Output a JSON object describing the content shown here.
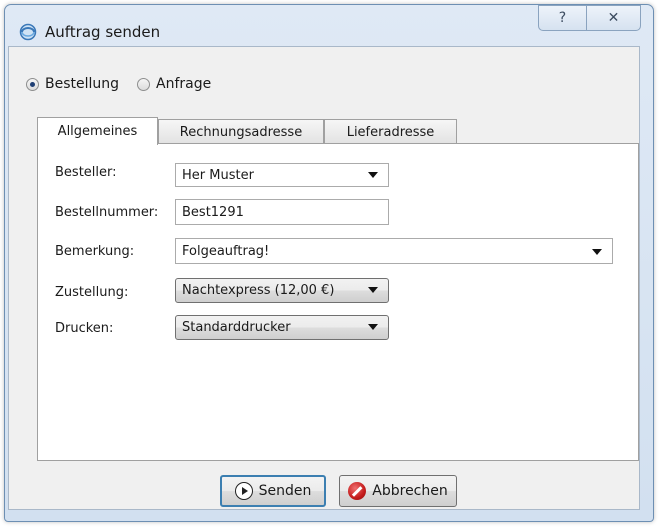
{
  "window": {
    "title": "Auftrag senden",
    "help_symbol": "?",
    "close_symbol": "✕"
  },
  "order_type": {
    "options": [
      {
        "label": "Bestellung",
        "checked": true
      },
      {
        "label": "Anfrage",
        "checked": false
      }
    ]
  },
  "tabs": [
    {
      "label": "Allgemeines",
      "active": true
    },
    {
      "label": "Rechnungsadresse",
      "active": false
    },
    {
      "label": "Lieferadresse",
      "active": false
    }
  ],
  "form": {
    "besteller": {
      "label": "Besteller:",
      "value": "Her Muster"
    },
    "bestellnummer": {
      "label": "Bestellnummer:",
      "value": "Best1291"
    },
    "bemerkung": {
      "label": "Bemerkung:",
      "value": "Folgeauftrag!"
    },
    "zustellung": {
      "label": "Zustellung:",
      "value": "Nachtexpress (12,00 €)"
    },
    "drucken": {
      "label": "Drucken:",
      "value": "Standarddrucker"
    }
  },
  "buttons": {
    "send_label": "Senden",
    "cancel_label": "Abbrechen"
  },
  "colors": {
    "titlebar": "#dfe9f5",
    "default_button_border": "#3c7fb1",
    "cancel_icon": "#c41b1b"
  }
}
